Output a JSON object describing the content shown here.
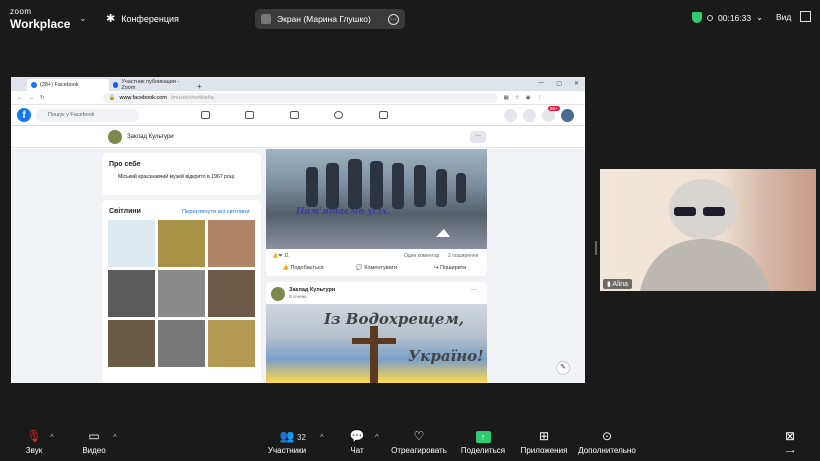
{
  "zoom": {
    "logo_top": "zoom",
    "logo_bottom": "Workplace",
    "meeting_label": "Конференция",
    "share_pill": "Экран (Марина Глушко)",
    "timer": "00:16:33",
    "view_label": "Вид",
    "participant_count": "32",
    "participant_name": "Alina",
    "toolbar": {
      "audio": "Звук",
      "video": "Видео",
      "participants": "Участники",
      "chat": "Чат",
      "react": "Отреагировать",
      "share": "Поделиться",
      "apps": "Приложения",
      "more": "Дополнительно"
    }
  },
  "browser": {
    "tab1": "(28+) Facebook",
    "tab2": "Участник публикации - Zoom",
    "url_domain": "www.facebook.com",
    "url_path": "/muzei/chortkiv/ta",
    "search_placeholder": "Пошук у Facebook",
    "notif_badge": "99+"
  },
  "facebook": {
    "page_name": "Заклад Культури",
    "about_title": "Про себе",
    "about_text": "Міський краєзнавчий музей відкрито в 1967 році.",
    "photos_title": "Світлини",
    "photos_link": "Переглянути всі світлини",
    "post1_caption": "Пам'ятаємо усіх.",
    "post1_reactions": "11",
    "post1_comments": "Один коментар",
    "post1_shares": "2 поширення",
    "like": "Подобається",
    "comment": "Коментувати",
    "share": "Поширити",
    "post2_author": "Заклад Культури",
    "post2_date": "6 січень",
    "greeting_line1": "Із Водохрещем,",
    "greeting_line2": "Україно!"
  }
}
